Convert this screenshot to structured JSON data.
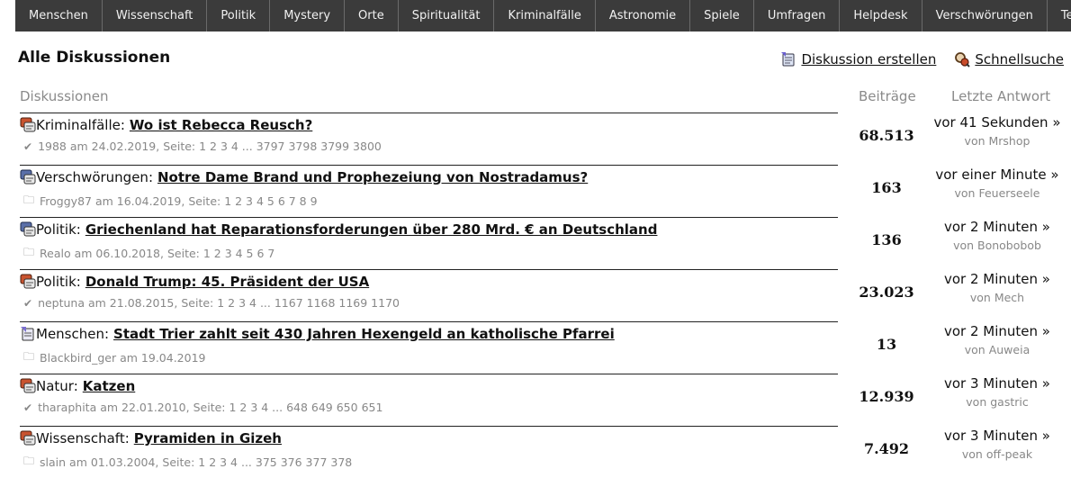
{
  "nav": [
    "Menschen",
    "Wissenschaft",
    "Politik",
    "Mystery",
    "Orte",
    "Spiritualität",
    "Kriminalfälle",
    "Astronomie",
    "Spiele",
    "Umfragen",
    "Helpdesk",
    "Verschwörungen",
    "Technologie"
  ],
  "page": {
    "title": "Alle Diskussionen",
    "create_label": "Diskussion erstellen",
    "search_label": "Schnellsuche"
  },
  "headers": {
    "discussions": "Diskussionen",
    "posts": "Beiträge",
    "last_reply": "Letzte Antwort"
  },
  "threads": [
    {
      "icon": "thread-hot-icon",
      "category": "Kriminalfälle:",
      "title": "Wo ist Rebecca Reusch?",
      "status_icon": "check-icon",
      "author": "1988",
      "date": "am 24.02.2019,",
      "pages": "Seite: 1 2 3 4 ... 3797 3798 3799 3800",
      "posts": "68.513",
      "last": "vor 41 Sekunden »",
      "last_by": "von Mrshop"
    },
    {
      "icon": "thread-normal-icon",
      "category": "Verschwörungen:",
      "title": "Notre Dame Brand und Prophezeiung von Nostradamus?",
      "status_icon": "folder-icon",
      "author": "Froggy87",
      "date": "am 16.04.2019,",
      "pages": "Seite: 1 2 3 4 5 6 7 8 9",
      "posts": "163",
      "last": "vor einer Minute »",
      "last_by": "von Feuerseele"
    },
    {
      "icon": "thread-normal-icon",
      "category": "Politik:",
      "title": "Griechenland hat Reparationsforderungen über 280 Mrd. € an Deutschland",
      "status_icon": "folder-icon",
      "author": "Realo",
      "date": "am 06.10.2018,",
      "pages": "Seite: 1 2 3 4 5 6 7",
      "posts": "136",
      "last": "vor 2 Minuten »",
      "last_by": "von Bonobobob"
    },
    {
      "icon": "thread-hot-icon",
      "category": "Politik:",
      "title": "Donald Trump: 45. Präsident der USA",
      "status_icon": "check-icon",
      "author": "neptuna",
      "date": "am 21.08.2015,",
      "pages": "Seite: 1 2 3 4 ... 1167 1168 1169 1170",
      "posts": "23.023",
      "last": "vor 2 Minuten »",
      "last_by": "von Mech"
    },
    {
      "icon": "thread-new-icon",
      "category": "Menschen:",
      "title": "Stadt Trier zahlt seit 430 Jahren Hexengeld an katholische Pfarrei",
      "status_icon": "folder-icon",
      "author": "Blackbird_ger",
      "date": "am 19.04.2019",
      "pages": "",
      "posts": "13",
      "last": "vor 2 Minuten »",
      "last_by": "von Auweia"
    },
    {
      "icon": "thread-hot-icon",
      "category": "Natur:",
      "title": "Katzen",
      "status_icon": "check-icon",
      "author": "tharaphita",
      "date": "am 22.01.2010,",
      "pages": "Seite: 1 2 3 4 ... 648 649 650 651",
      "posts": "12.939",
      "last": "vor 3 Minuten »",
      "last_by": "von gastric"
    },
    {
      "icon": "thread-hot-icon",
      "category": "Wissenschaft:",
      "title": "Pyramiden in Gizeh",
      "status_icon": "folder-icon",
      "author": "slain",
      "date": "am 01.03.2004,",
      "pages": "Seite: 1 2 3 4 ... 375 376 377 378",
      "posts": "7.492",
      "last": "vor 3 Minuten »",
      "last_by": "von off-peak"
    }
  ],
  "colors": {
    "nav_bg": "#3b3b3b",
    "hot": "#c8532f",
    "normal": "#5a6fa8",
    "new": "#7a6fd0"
  }
}
